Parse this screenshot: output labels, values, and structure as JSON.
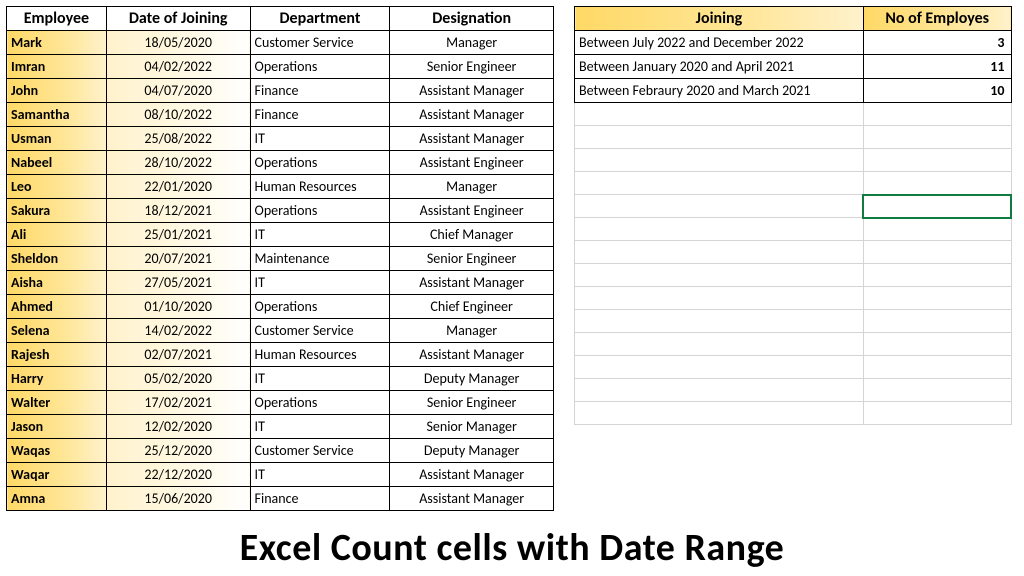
{
  "employees_table": {
    "headers": {
      "employee": "Employee",
      "date_of_joining": "Date of Joining",
      "department": "Department",
      "designation": "Designation"
    },
    "rows": [
      {
        "employee": "Mark",
        "date": "18/05/2020",
        "department": "Customer Service",
        "designation": "Manager"
      },
      {
        "employee": "Imran",
        "date": "04/02/2022",
        "department": "Operations",
        "designation": "Senior Engineer"
      },
      {
        "employee": "John",
        "date": "04/07/2020",
        "department": "Finance",
        "designation": "Assistant Manager"
      },
      {
        "employee": "Samantha",
        "date": "08/10/2022",
        "department": "Finance",
        "designation": "Assistant Manager"
      },
      {
        "employee": "Usman",
        "date": "25/08/2022",
        "department": "IT",
        "designation": "Assistant Manager"
      },
      {
        "employee": "Nabeel",
        "date": "28/10/2022",
        "department": "Operations",
        "designation": "Assistant Engineer"
      },
      {
        "employee": "Leo",
        "date": "22/01/2020",
        "department": "Human Resources",
        "designation": "Manager"
      },
      {
        "employee": "Sakura",
        "date": "18/12/2021",
        "department": "Operations",
        "designation": "Assistant Engineer"
      },
      {
        "employee": "Ali",
        "date": "25/01/2021",
        "department": "IT",
        "designation": "Chief Manager"
      },
      {
        "employee": "Sheldon",
        "date": "20/07/2021",
        "department": "Maintenance",
        "designation": "Senior Engineer"
      },
      {
        "employee": "Aisha",
        "date": "27/05/2021",
        "department": "IT",
        "designation": "Assistant Manager"
      },
      {
        "employee": "Ahmed",
        "date": "01/10/2020",
        "department": "Operations",
        "designation": "Chief Engineer"
      },
      {
        "employee": "Selena",
        "date": "14/02/2022",
        "department": "Customer Service",
        "designation": "Manager"
      },
      {
        "employee": "Rajesh",
        "date": "02/07/2021",
        "department": "Human Resources",
        "designation": "Assistant Manager"
      },
      {
        "employee": "Harry",
        "date": "05/02/2020",
        "department": "IT",
        "designation": "Deputy Manager"
      },
      {
        "employee": "Walter",
        "date": "17/02/2021",
        "department": "Operations",
        "designation": "Senior Engineer"
      },
      {
        "employee": "Jason",
        "date": "12/02/2020",
        "department": "IT",
        "designation": "Senior Manager"
      },
      {
        "employee": "Waqas",
        "date": "25/12/2020",
        "department": "Customer Service",
        "designation": "Deputy Manager"
      },
      {
        "employee": "Waqar",
        "date": "22/12/2020",
        "department": "IT",
        "designation": "Assistant Manager"
      },
      {
        "employee": "Amna",
        "date": "15/06/2020",
        "department": "Finance",
        "designation": "Assistant Manager"
      }
    ]
  },
  "summary_table": {
    "headers": {
      "joining": "Joining",
      "count": "No of Employes"
    },
    "rows": [
      {
        "joining": "Between July 2022 and December 2022",
        "count": "3"
      },
      {
        "joining": "Between January 2020 and April 2021",
        "count": "11"
      },
      {
        "joining": "Between Febraury 2020 and March 2021",
        "count": "10"
      }
    ]
  },
  "title": "Excel Count cells with Date Range"
}
